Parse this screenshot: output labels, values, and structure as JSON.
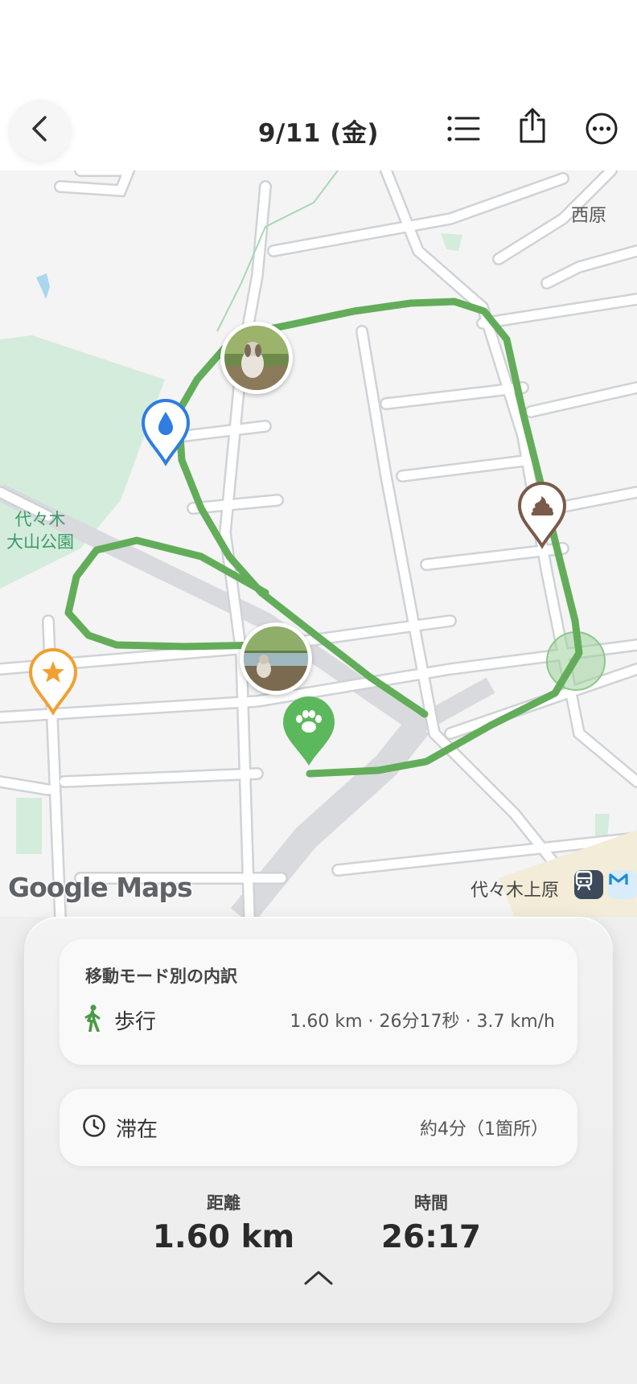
{
  "header": {
    "title": "9/11 (金)",
    "back_icon": "chevron-left-icon",
    "actions": [
      "list-icon",
      "share-icon",
      "more-icon"
    ]
  },
  "map": {
    "labels": {
      "nishihara": "西原",
      "park": "代々木\n大山公園",
      "station": "代々木上原"
    },
    "attribution": "Google Maps",
    "route_color": "#63ad5a",
    "markers": [
      {
        "name": "water-marker",
        "icon": "water-drop-icon",
        "color": "#2f7de1"
      },
      {
        "name": "poop-marker",
        "icon": "poop-icon",
        "color": "#7a5a4a"
      },
      {
        "name": "star-marker",
        "icon": "star-icon",
        "color": "#f0a030"
      },
      {
        "name": "start-marker",
        "icon": "paw-icon",
        "color": "#5cb85c"
      },
      {
        "name": "photo-1",
        "icon": "dog-photo"
      },
      {
        "name": "photo-2",
        "icon": "dog-photo"
      }
    ]
  },
  "breakdown": {
    "heading": "移動モード別の内訳",
    "mode_icon": "walking-icon",
    "mode_label": "歩行",
    "stats": "1.60 km · 26分17秒 · 3.7 km/h"
  },
  "stay": {
    "icon": "clock-icon",
    "label": "滞在",
    "value": "約4分（1箇所）"
  },
  "summary": {
    "distance_label": "距離",
    "distance_value": "1.60 km",
    "time_label": "時間",
    "time_value": "26:17"
  }
}
